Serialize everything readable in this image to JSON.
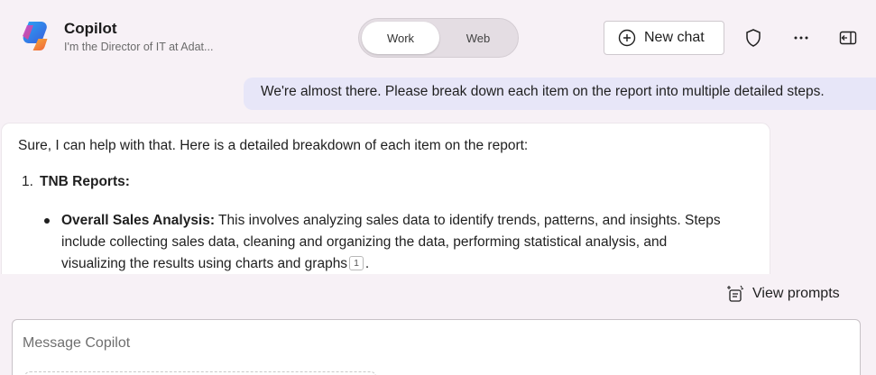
{
  "header": {
    "app_title": "Copilot",
    "app_subtitle": "I'm the Director of IT at Adat...",
    "logo_icon": "copilot-logo-icon",
    "mode_toggle": {
      "options": [
        "Work",
        "Web"
      ],
      "selected": "Work"
    },
    "new_chat_label": "New chat",
    "icons": [
      "plus-circle-icon",
      "shield-icon",
      "more-options-icon",
      "sidebar-toggle-icon"
    ]
  },
  "conversation": {
    "user_message": "We're almost there. Please break down each item on the report into multiple detailed steps.",
    "assistant": {
      "intro": "Sure, I can help with that. Here is a detailed breakdown of each item on the report:",
      "list": [
        {
          "number": "1.",
          "heading": "TNB Reports:",
          "bullets": [
            {
              "title": "Overall Sales Analysis:",
              "text": " This involves analyzing sales data to identify trends, patterns, and insights. Steps include collecting sales data, cleaning and organizing the data, performing statistical analysis, and visualizing the results using charts and graphs",
              "citation": "1",
              "tail": "."
            }
          ]
        }
      ]
    }
  },
  "view_prompts_label": "View prompts",
  "composer": {
    "placeholder": "Message Copilot",
    "value": ""
  },
  "colors": {
    "background": "#f7f1f6",
    "user_bubble": "#e7e6f8",
    "assistant_bubble": "#ffffff"
  }
}
